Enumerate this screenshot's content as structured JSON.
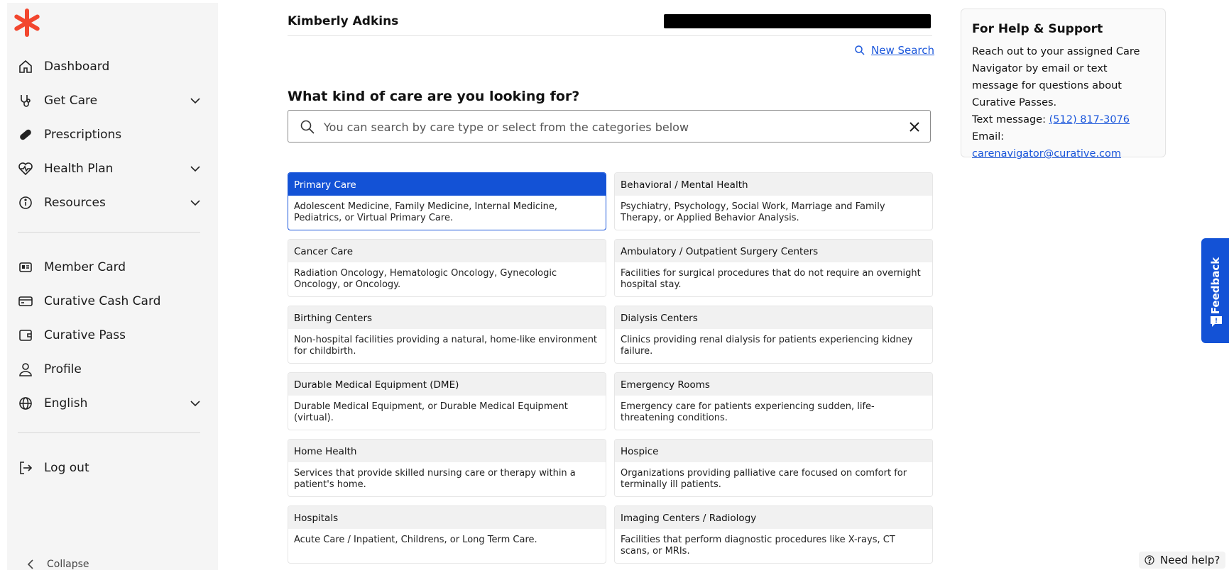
{
  "sidebar": {
    "items": [
      {
        "label": "Dashboard",
        "icon": "home-icon"
      },
      {
        "label": "Get Care",
        "icon": "stethoscope-icon"
      },
      {
        "label": "Prescriptions",
        "icon": "pill-icon"
      },
      {
        "label": "Health Plan",
        "icon": "heart-pulse-icon"
      },
      {
        "label": "Resources",
        "icon": "info-icon"
      },
      {
        "label": "Member Card",
        "icon": "id-card-icon"
      },
      {
        "label": "Curative Cash Card",
        "icon": "credit-card-icon"
      },
      {
        "label": "Curative Pass",
        "icon": "wallet-icon"
      },
      {
        "label": "Profile",
        "icon": "user-icon"
      },
      {
        "label": "English",
        "icon": "globe-icon"
      },
      {
        "label": "Log out",
        "icon": "logout-icon"
      }
    ],
    "collapse_label": "Collapse"
  },
  "header": {
    "user_name": "Kimberly Adkins",
    "new_search_label": "New Search"
  },
  "main": {
    "question": "What kind of care are you looking for?",
    "search_placeholder": "You can search by care type or select from the categories below",
    "categories": [
      {
        "title": "Primary Care",
        "desc": "Adolescent Medicine, Family Medicine, Internal Medicine, Pediatrics, or Virtual Primary Care.",
        "selected": true
      },
      {
        "title": "Behavioral / Mental Health",
        "desc": "Psychiatry, Psychology, Social Work, Marriage and Family Therapy, or Applied Behavior Analysis."
      },
      {
        "title": "Cancer Care",
        "desc": "Radiation Oncology, Hematologic Oncology, Gynecologic Oncology, or Oncology."
      },
      {
        "title": "Ambulatory / Outpatient Surgery Centers",
        "desc": "Facilities for surgical procedures that do not require an overnight hospital stay."
      },
      {
        "title": "Birthing Centers",
        "desc": "Non-hospital facilities providing a natural, home-like environment for childbirth."
      },
      {
        "title": "Dialysis Centers",
        "desc": "Clinics providing renal dialysis for patients experiencing kidney failure."
      },
      {
        "title": "Durable Medical Equipment (DME)",
        "desc": "Durable Medical Equipment, or Durable Medical Equipment (virtual)."
      },
      {
        "title": "Emergency Rooms",
        "desc": "Emergency care for patients experiencing sudden, life-threatening conditions."
      },
      {
        "title": "Home Health",
        "desc": "Services that provide skilled nursing care or therapy within a patient's home."
      },
      {
        "title": "Hospice",
        "desc": "Organizations providing palliative care focused on comfort for terminally ill patients."
      },
      {
        "title": "Hospitals",
        "desc": "Acute Care / Inpatient, Childrens, or Long Term Care."
      },
      {
        "title": "Imaging Centers / Radiology",
        "desc": "Facilities that perform diagnostic procedures like X-rays, CT scans, or MRIs."
      }
    ]
  },
  "help": {
    "title": "For Help & Support",
    "body": "Reach out to your assigned Care Navigator by email or text message for questions about Curative Passes.",
    "text_label": "Text message:",
    "phone": "(512) 817-3076",
    "email_label": "Email:",
    "email": "carenavigator@curative.com"
  },
  "feedback_label": "Feedback",
  "need_help_label": "Need help?",
  "colors": {
    "accent": "#1352d6",
    "brand": "#f2462e"
  }
}
